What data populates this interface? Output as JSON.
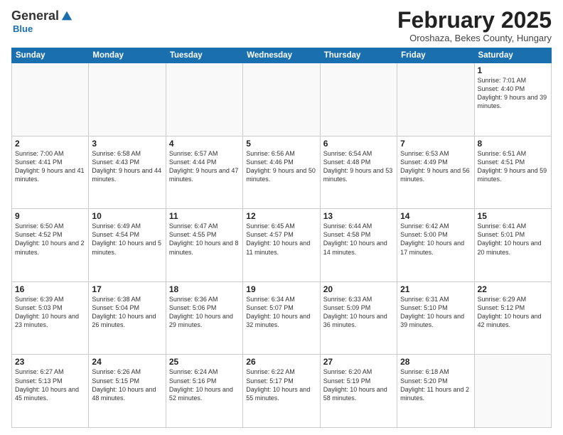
{
  "logo": {
    "general": "General",
    "blue": "Blue"
  },
  "header": {
    "month_title": "February 2025",
    "location": "Oroshaza, Bekes County, Hungary"
  },
  "days_of_week": [
    "Sunday",
    "Monday",
    "Tuesday",
    "Wednesday",
    "Thursday",
    "Friday",
    "Saturday"
  ],
  "weeks": [
    [
      {
        "day": "",
        "text": ""
      },
      {
        "day": "",
        "text": ""
      },
      {
        "day": "",
        "text": ""
      },
      {
        "day": "",
        "text": ""
      },
      {
        "day": "",
        "text": ""
      },
      {
        "day": "",
        "text": ""
      },
      {
        "day": "1",
        "text": "Sunrise: 7:01 AM\nSunset: 4:40 PM\nDaylight: 9 hours and 39 minutes."
      }
    ],
    [
      {
        "day": "2",
        "text": "Sunrise: 7:00 AM\nSunset: 4:41 PM\nDaylight: 9 hours and 41 minutes."
      },
      {
        "day": "3",
        "text": "Sunrise: 6:58 AM\nSunset: 4:43 PM\nDaylight: 9 hours and 44 minutes."
      },
      {
        "day": "4",
        "text": "Sunrise: 6:57 AM\nSunset: 4:44 PM\nDaylight: 9 hours and 47 minutes."
      },
      {
        "day": "5",
        "text": "Sunrise: 6:56 AM\nSunset: 4:46 PM\nDaylight: 9 hours and 50 minutes."
      },
      {
        "day": "6",
        "text": "Sunrise: 6:54 AM\nSunset: 4:48 PM\nDaylight: 9 hours and 53 minutes."
      },
      {
        "day": "7",
        "text": "Sunrise: 6:53 AM\nSunset: 4:49 PM\nDaylight: 9 hours and 56 minutes."
      },
      {
        "day": "8",
        "text": "Sunrise: 6:51 AM\nSunset: 4:51 PM\nDaylight: 9 hours and 59 minutes."
      }
    ],
    [
      {
        "day": "9",
        "text": "Sunrise: 6:50 AM\nSunset: 4:52 PM\nDaylight: 10 hours and 2 minutes."
      },
      {
        "day": "10",
        "text": "Sunrise: 6:49 AM\nSunset: 4:54 PM\nDaylight: 10 hours and 5 minutes."
      },
      {
        "day": "11",
        "text": "Sunrise: 6:47 AM\nSunset: 4:55 PM\nDaylight: 10 hours and 8 minutes."
      },
      {
        "day": "12",
        "text": "Sunrise: 6:45 AM\nSunset: 4:57 PM\nDaylight: 10 hours and 11 minutes."
      },
      {
        "day": "13",
        "text": "Sunrise: 6:44 AM\nSunset: 4:58 PM\nDaylight: 10 hours and 14 minutes."
      },
      {
        "day": "14",
        "text": "Sunrise: 6:42 AM\nSunset: 5:00 PM\nDaylight: 10 hours and 17 minutes."
      },
      {
        "day": "15",
        "text": "Sunrise: 6:41 AM\nSunset: 5:01 PM\nDaylight: 10 hours and 20 minutes."
      }
    ],
    [
      {
        "day": "16",
        "text": "Sunrise: 6:39 AM\nSunset: 5:03 PM\nDaylight: 10 hours and 23 minutes."
      },
      {
        "day": "17",
        "text": "Sunrise: 6:38 AM\nSunset: 5:04 PM\nDaylight: 10 hours and 26 minutes."
      },
      {
        "day": "18",
        "text": "Sunrise: 6:36 AM\nSunset: 5:06 PM\nDaylight: 10 hours and 29 minutes."
      },
      {
        "day": "19",
        "text": "Sunrise: 6:34 AM\nSunset: 5:07 PM\nDaylight: 10 hours and 32 minutes."
      },
      {
        "day": "20",
        "text": "Sunrise: 6:33 AM\nSunset: 5:09 PM\nDaylight: 10 hours and 36 minutes."
      },
      {
        "day": "21",
        "text": "Sunrise: 6:31 AM\nSunset: 5:10 PM\nDaylight: 10 hours and 39 minutes."
      },
      {
        "day": "22",
        "text": "Sunrise: 6:29 AM\nSunset: 5:12 PM\nDaylight: 10 hours and 42 minutes."
      }
    ],
    [
      {
        "day": "23",
        "text": "Sunrise: 6:27 AM\nSunset: 5:13 PM\nDaylight: 10 hours and 45 minutes."
      },
      {
        "day": "24",
        "text": "Sunrise: 6:26 AM\nSunset: 5:15 PM\nDaylight: 10 hours and 48 minutes."
      },
      {
        "day": "25",
        "text": "Sunrise: 6:24 AM\nSunset: 5:16 PM\nDaylight: 10 hours and 52 minutes."
      },
      {
        "day": "26",
        "text": "Sunrise: 6:22 AM\nSunset: 5:17 PM\nDaylight: 10 hours and 55 minutes."
      },
      {
        "day": "27",
        "text": "Sunrise: 6:20 AM\nSunset: 5:19 PM\nDaylight: 10 hours and 58 minutes."
      },
      {
        "day": "28",
        "text": "Sunrise: 6:18 AM\nSunset: 5:20 PM\nDaylight: 11 hours and 2 minutes."
      },
      {
        "day": "",
        "text": ""
      }
    ]
  ]
}
